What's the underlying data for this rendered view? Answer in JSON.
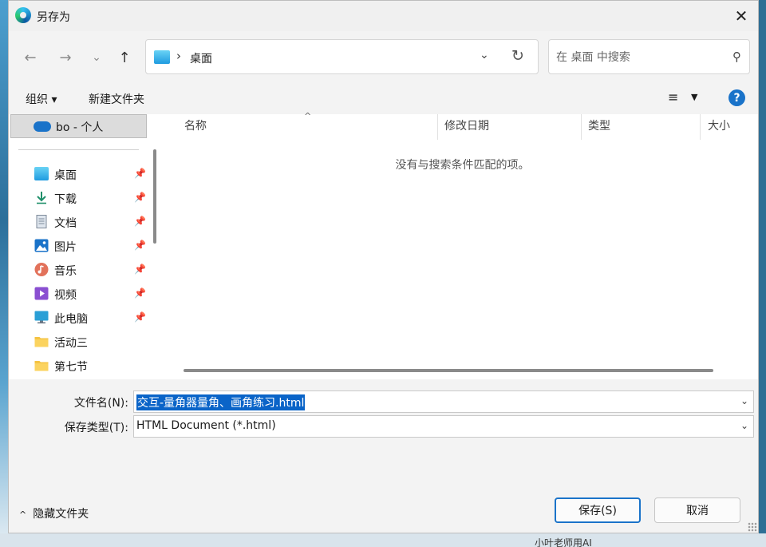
{
  "window": {
    "title": "另存为",
    "close_glyph": "✕"
  },
  "navigation": {
    "back_glyph": "←",
    "forward_glyph": "→",
    "recent_glyph": "⌄",
    "up_glyph": "↑",
    "address": {
      "separator": "›",
      "location": "桌面",
      "dropdown_glyph": "⌄",
      "refresh_glyph": "↻"
    },
    "search": {
      "placeholder": "在 桌面 中搜索",
      "icon_glyph": "⚲"
    }
  },
  "toolbar": {
    "organize_label": "组织 ▾",
    "new_folder_label": "新建文件夹",
    "view_glyph": "≡",
    "view_dropdown_glyph": "▼",
    "help_glyph": "?"
  },
  "sidebar": {
    "onedrive_label": "bo - 个人",
    "pin_glyph": "📌",
    "items": [
      {
        "label": "桌面",
        "icon": "desktop-icon",
        "pinned": true
      },
      {
        "label": "下载",
        "icon": "download-icon",
        "pinned": true
      },
      {
        "label": "文档",
        "icon": "document-icon",
        "pinned": true
      },
      {
        "label": "图片",
        "icon": "picture-icon",
        "pinned": true
      },
      {
        "label": "音乐",
        "icon": "music-icon",
        "pinned": true
      },
      {
        "label": "视频",
        "icon": "video-icon",
        "pinned": true
      },
      {
        "label": "此电脑",
        "icon": "computer-icon",
        "pinned": true
      },
      {
        "label": "活动三",
        "icon": "folder-icon",
        "pinned": false
      },
      {
        "label": "第七节",
        "icon": "folder-icon",
        "pinned": false
      }
    ]
  },
  "file_list": {
    "sort_caret": "^",
    "columns": [
      "名称",
      "修改日期",
      "类型",
      "大小"
    ],
    "empty_message": "没有与搜索条件匹配的项。"
  },
  "form": {
    "filename_label": "文件名(N):",
    "filename_value": "交互-量角器量角、画角练习.html",
    "filetype_label": "保存类型(T):",
    "filetype_value": "HTML Document (*.html)",
    "dropdown_glyph": "⌄"
  },
  "footer": {
    "hide_folders_chevron": "^",
    "hide_folders_label": "隐藏文件夹",
    "save_label": "保存(S)",
    "cancel_label": "取消"
  },
  "background": {
    "partial_text": "小叶老师用AI"
  },
  "colors": {
    "accent": "#1a73c9",
    "selection": "#0a64c8",
    "dialog_bg": "#f3f3f3"
  }
}
